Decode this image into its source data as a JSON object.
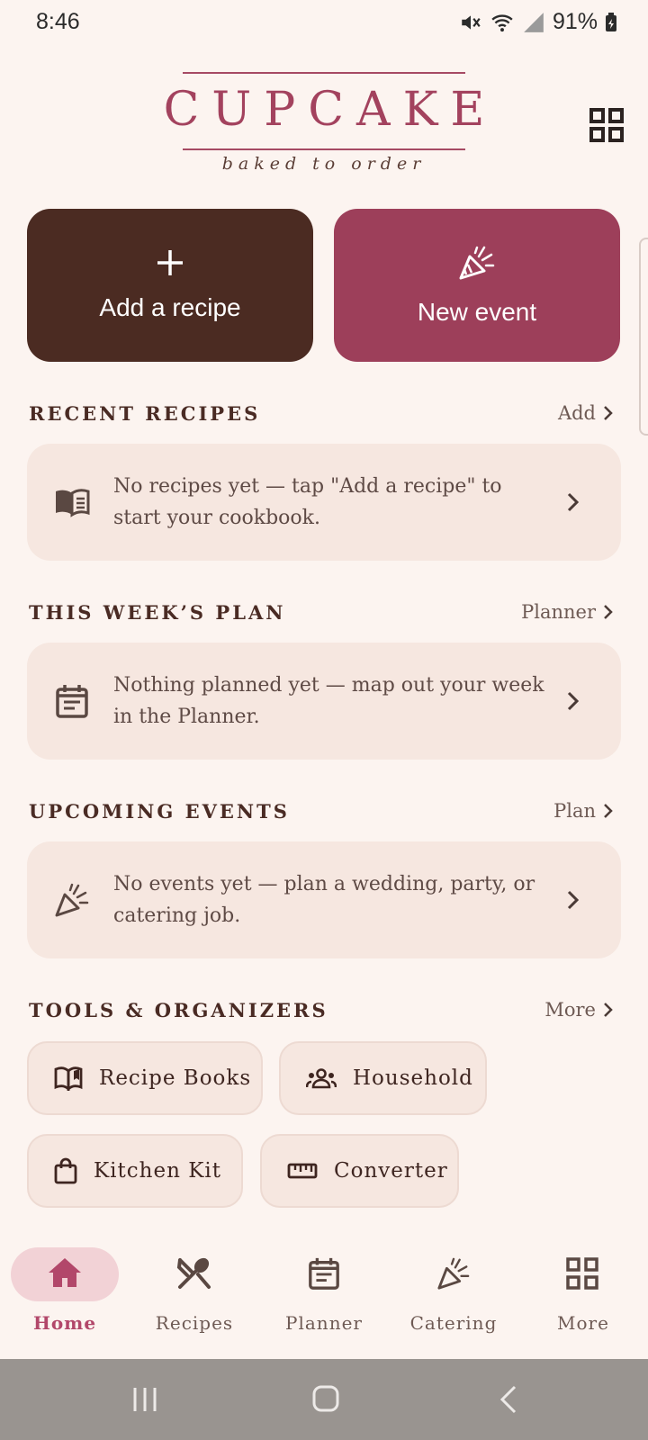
{
  "status_bar": {
    "time": "8:46",
    "battery": "91%"
  },
  "logo": {
    "title": "CUPCAKE",
    "subtitle": "baked to order"
  },
  "actions": {
    "add_recipe": "Add a recipe",
    "new_event": "New event"
  },
  "sections": [
    {
      "title": "RECENT RECIPES",
      "link": "Add",
      "text": "No recipes yet — tap \"Add a recipe\" to start your cookbook.",
      "icon": "book-icon"
    },
    {
      "title": "THIS WEEK’S PLAN",
      "link": "Planner",
      "text": "Nothing planned yet — map out your week in the Planner.",
      "icon": "calendar-icon"
    },
    {
      "title": "UPCOMING EVENTS",
      "link": "Plan",
      "text": "No events yet — plan a wedding, party, or catering job.",
      "icon": "party-popper-icon"
    }
  ],
  "tools": {
    "title": "TOOLS & ORGANIZERS",
    "link": "More",
    "chips": [
      "Recipe Books",
      "Household",
      "Kitchen Kit",
      "Converter"
    ]
  },
  "nav": {
    "items": [
      "Home",
      "Recipes",
      "Planner",
      "Catering",
      "More"
    ],
    "active": "Home"
  },
  "colors": {
    "background": "#FCF4F0",
    "brand": "#A3425E",
    "dark_button": "#4B2B22",
    "accent_button": "#9D3F5A",
    "card": "#F6E7E0"
  }
}
